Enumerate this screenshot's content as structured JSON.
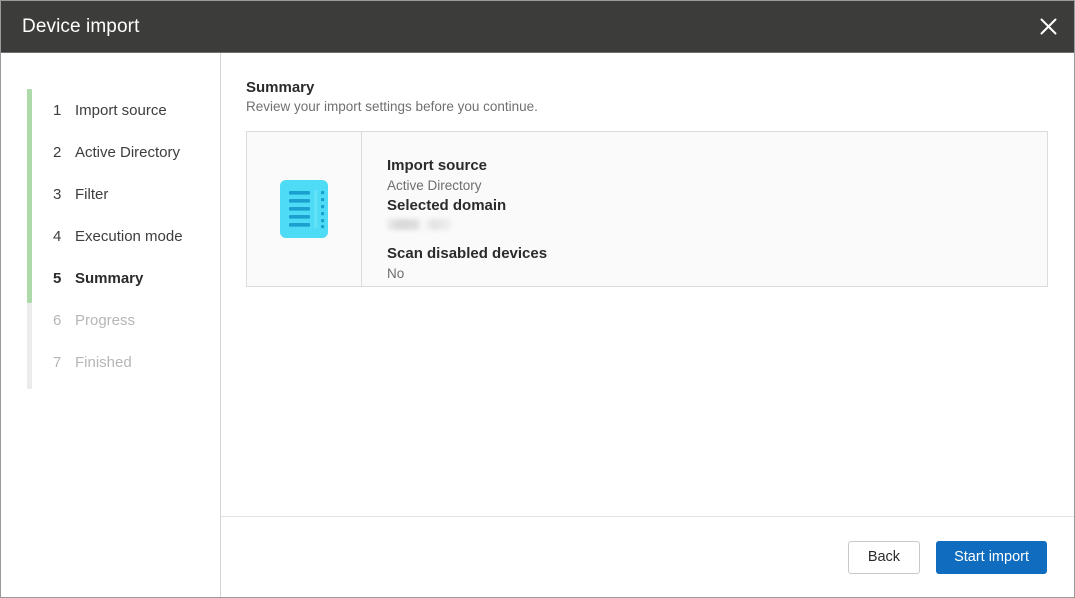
{
  "window": {
    "title": "Device import",
    "close_icon": "close-icon"
  },
  "sidebar": {
    "steps": [
      {
        "num": "1",
        "label": "Import source",
        "state": "done"
      },
      {
        "num": "2",
        "label": "Active Directory",
        "state": "done"
      },
      {
        "num": "3",
        "label": "Filter",
        "state": "done"
      },
      {
        "num": "4",
        "label": "Execution mode",
        "state": "done"
      },
      {
        "num": "5",
        "label": "Summary",
        "state": "active"
      },
      {
        "num": "6",
        "label": "Progress",
        "state": "disabled"
      },
      {
        "num": "7",
        "label": "Finished",
        "state": "disabled"
      }
    ],
    "rail_done_color": "#aedaa9",
    "rail_todo_color": "#ebebeb"
  },
  "main": {
    "title": "Summary",
    "subtitle": "Review your import settings before you continue.",
    "card": {
      "icon": "document-list-icon",
      "icon_color": "#4ddbf5",
      "fields": [
        {
          "label": "Import source",
          "value": "Active Directory",
          "redacted": false
        },
        {
          "label": "Selected domain",
          "value": "",
          "redacted": true
        },
        {
          "label": "Scan disabled devices",
          "value": "No",
          "redacted": false
        }
      ]
    }
  },
  "footer": {
    "back_label": "Back",
    "start_label": "Start import",
    "primary_color": "#0f6cbf"
  }
}
